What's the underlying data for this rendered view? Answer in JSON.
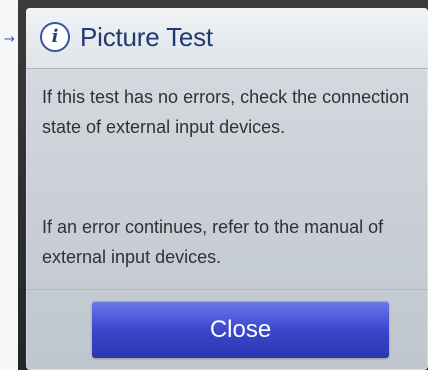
{
  "dialog": {
    "icon": "info-icon",
    "icon_glyph": "i",
    "title": "Picture Test",
    "message_1_line_1": "If this test has no errors, check the connection",
    "message_1_line_2": "state of external input devices.",
    "message_2_line_1": "If an error continues, refer to the manual of",
    "message_2_line_2": "external input devices.",
    "close_label": "Close"
  },
  "colors": {
    "title": "#223a72",
    "button": "#3a46cc",
    "dialog_bg": "#cbd1d7"
  }
}
